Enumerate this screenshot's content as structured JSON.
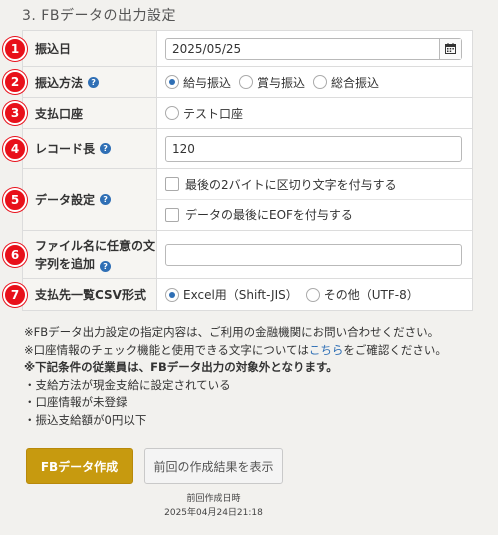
{
  "section_title": "3. FBデータの出力設定",
  "rows": {
    "transfer_date": {
      "badge": "1",
      "label": "振込日",
      "value": "2025/05/25"
    },
    "transfer_method": {
      "badge": "2",
      "label": "振込方法",
      "options": [
        "給与振込",
        "賞与振込",
        "総合振込"
      ],
      "selected": "給与振込"
    },
    "payment_account": {
      "badge": "3",
      "label": "支払口座",
      "options": [
        "テスト口座"
      ]
    },
    "record_length": {
      "badge": "4",
      "label": "レコード長",
      "value": "120"
    },
    "data_settings": {
      "badge": "5",
      "label": "データ設定",
      "checkboxes": [
        "最後の2バイトに区切り文字を付与する",
        "データの最後にEOFを付与する"
      ]
    },
    "filename_string": {
      "badge": "6",
      "label_line1": "ファイル名に任意の文",
      "label_line2": "字列を追加",
      "value": ""
    },
    "csv_format": {
      "badge": "7",
      "label": "支払先一覧CSV形式",
      "options": [
        "Excel用（Shift-JIS）",
        "その他（UTF-8）"
      ],
      "selected": "Excel用（Shift-JIS）"
    }
  },
  "notes": {
    "line1": "※FBデータ出力設定の指定内容は、ご利用の金融機関にお問い合わせください。",
    "line2_pre": "※口座情報のチェック機能と使用できる文字については",
    "line2_link": "こちら",
    "line2_post": "をご確認ください。",
    "line3": "※下記条件の従業員は、FBデータ出力の対象外となります。",
    "items": [
      "・支給方法が現金支給に設定されている",
      "・口座情報が未登録",
      "・振込支給額が0円以下"
    ]
  },
  "buttons": {
    "create": "FBデータ作成",
    "show_previous": "前回の作成結果を表示"
  },
  "last_created": {
    "label": "前回作成日時",
    "value": "2025年04月24日21:18"
  },
  "colors": {
    "badge": "#e8101a",
    "primary_button": "#c79a0f",
    "help_icon": "#2f6fb5",
    "link": "#2f6fb5"
  }
}
